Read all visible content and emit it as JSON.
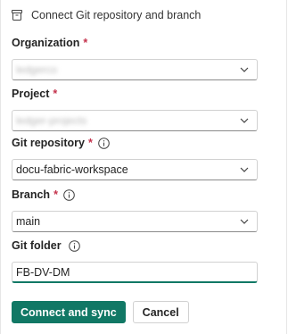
{
  "header": {
    "title": "Connect Git repository and branch",
    "icon": "repository-icon"
  },
  "fields": {
    "organization": {
      "label": "Organization",
      "required_mark": "*",
      "value": "ledgerco",
      "value_obscured": true
    },
    "project": {
      "label": "Project",
      "required_mark": "*",
      "value": "ledger-projects",
      "value_obscured": true
    },
    "git_repository": {
      "label": "Git repository",
      "required_mark": "*",
      "value": "docu-fabric-workspace"
    },
    "branch": {
      "label": "Branch",
      "required_mark": "*",
      "value": "main"
    },
    "git_folder": {
      "label": "Git folder",
      "value": "FB-DV-DM"
    }
  },
  "actions": {
    "connect_label": "Connect and sync",
    "cancel_label": "Cancel"
  },
  "colors": {
    "accent": "#117865",
    "required": "#c4314b",
    "border": "#d1d1d1"
  }
}
